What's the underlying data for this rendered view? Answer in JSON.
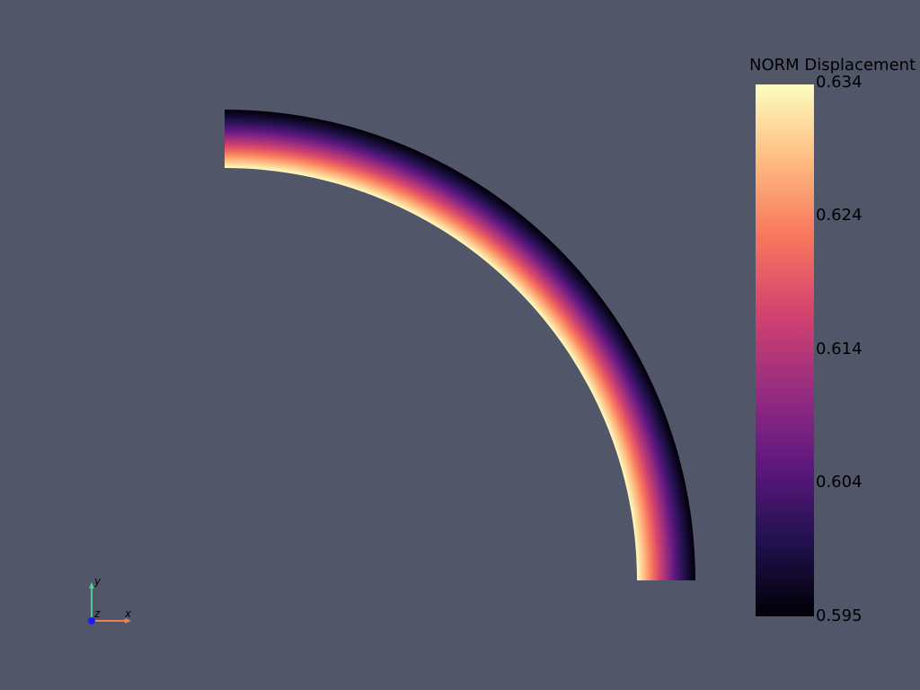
{
  "viewer": {
    "background_color": "#525669",
    "colormap": "magma",
    "colormap_stops": [
      "#000004",
      "#221150",
      "#5f187f",
      "#982d80",
      "#d3436e",
      "#f8765c",
      "#febb81",
      "#fcfdbf"
    ]
  },
  "scalar_bar": {
    "title": "NORM Displacement",
    "ticks": [
      "0.634",
      "0.624",
      "0.614",
      "0.604",
      "0.595"
    ],
    "min": 0.595,
    "max": 0.634
  },
  "field": {
    "name": "NORM Displacement",
    "inner_edge_value": 0.634,
    "outer_edge_value": 0.595
  },
  "axes": {
    "x_label": "x",
    "y_label": "y",
    "z_label": "z",
    "x_color": "#f0805a",
    "y_color": "#5cc69a",
    "z_color": "#1a1aff"
  }
}
